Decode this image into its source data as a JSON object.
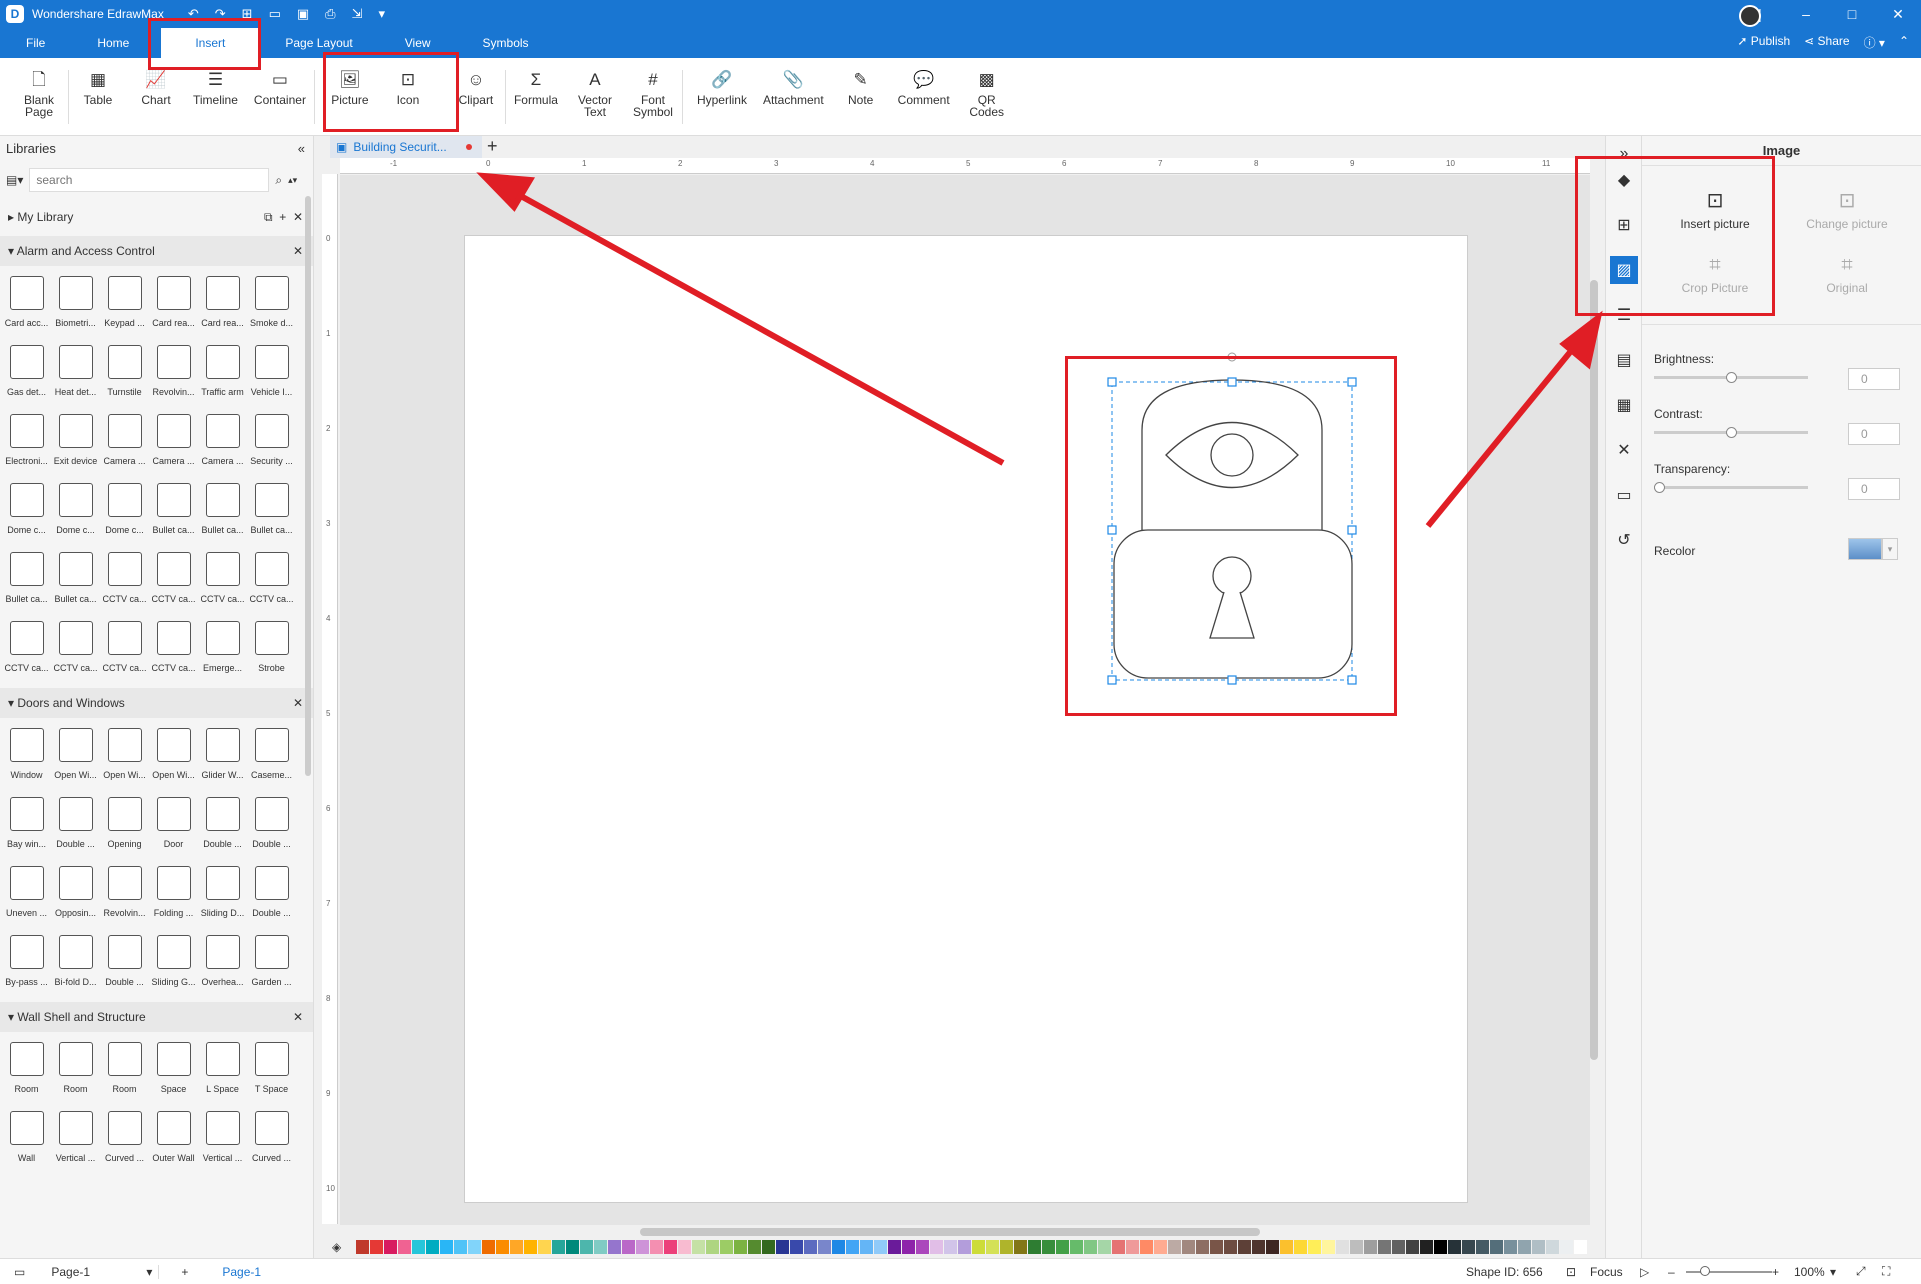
{
  "app": {
    "title": "Wondershare EdrawMax"
  },
  "menu": {
    "tabs": [
      "File",
      "Home",
      "Insert",
      "Page Layout",
      "View",
      "Symbols"
    ],
    "publish": "Publish",
    "share": "Share"
  },
  "ribbon": {
    "blank_page": "Blank\nPage",
    "table": "Table",
    "chart": "Chart",
    "timeline": "Timeline",
    "container": "Container",
    "picture": "Picture",
    "icon": "Icon",
    "clipart": "Clipart",
    "formula": "Formula",
    "vector_text": "Vector\nText",
    "font_symbol": "Font\nSymbol",
    "hyperlink": "Hyperlink",
    "attachment": "Attachment",
    "note": "Note",
    "comment": "Comment",
    "qr_codes": "QR\nCodes"
  },
  "libraries": {
    "title": "Libraries",
    "search_placeholder": "search",
    "my_library": "My Library",
    "sections": [
      {
        "name": "Alarm and Access Control",
        "shapes": [
          "Card acc...",
          "Biometri...",
          "Keypad ...",
          "Card rea...",
          "Card rea...",
          "Smoke d...",
          "Gas det...",
          "Heat det...",
          "Turnstile",
          "Revolvin...",
          "Traffic arm",
          "Vehicle I...",
          "Electroni...",
          "Exit device",
          "Camera ...",
          "Camera ...",
          "Camera ...",
          "Security ...",
          "Dome c...",
          "Dome c...",
          "Dome c...",
          "Bullet ca...",
          "Bullet ca...",
          "Bullet ca...",
          "Bullet ca...",
          "Bullet ca...",
          "CCTV ca...",
          "CCTV ca...",
          "CCTV ca...",
          "CCTV ca...",
          "CCTV ca...",
          "CCTV ca...",
          "CCTV ca...",
          "CCTV ca...",
          "Emerge...",
          "Strobe"
        ]
      },
      {
        "name": "Doors and Windows",
        "shapes": [
          "Window",
          "Open Wi...",
          "Open Wi...",
          "Open Wi...",
          "Glider W...",
          "Caseme...",
          "Bay win...",
          "Double ...",
          "Opening",
          "Door",
          "Double ...",
          "Double ...",
          "Uneven ...",
          "Opposin...",
          "Revolvin...",
          "Folding ...",
          "Sliding D...",
          "Double ...",
          "By-pass ...",
          "Bi-fold D...",
          "Double ...",
          "Sliding G...",
          "Overhea...",
          "Garden ..."
        ]
      },
      {
        "name": "Wall Shell and Structure",
        "shapes": [
          "Room",
          "Room",
          "Room",
          "Space",
          "L Space",
          "T Space",
          "Wall",
          "Vertical ...",
          "Curved ...",
          "Outer Wall",
          "Vertical ...",
          "Curved ..."
        ]
      }
    ]
  },
  "document": {
    "tab_name": "Building Securit..."
  },
  "ruler": {
    "h": [
      "-1",
      "0",
      "1",
      "2",
      "3",
      "4",
      "5",
      "6",
      "7",
      "8",
      "9",
      "10",
      "11"
    ],
    "v": [
      "0",
      "1",
      "2",
      "3",
      "4",
      "5",
      "6",
      "7",
      "8",
      "9",
      "10"
    ]
  },
  "panel": {
    "title": "Image",
    "insert_picture": "Insert picture",
    "change_picture": "Change picture",
    "crop_picture": "Crop Picture",
    "original": "Original",
    "brightness": "Brightness:",
    "contrast": "Contrast:",
    "transparency": "Transparency:",
    "recolor": "Recolor",
    "brightness_value": "0",
    "contrast_value": "0",
    "transparency_value": "0"
  },
  "status": {
    "page_select": "Page-1",
    "page_tab": "Page-1",
    "shape_id": "Shape ID: 656",
    "focus": "Focus",
    "zoom": "100%"
  },
  "colors": {
    "accent": "#1976d2",
    "highlight": "#e01e25",
    "palette": [
      "#c0392b",
      "#e53935",
      "#d81b60",
      "#f06292",
      "#26c6da",
      "#00acc1",
      "#29b6f6",
      "#4fc3f7",
      "#81d4fa",
      "#ef6c00",
      "#fb8c00",
      "#ffa726",
      "#ffb300",
      "#ffd54f",
      "#26a69a",
      "#00897b",
      "#4db6ac",
      "#80cbc4",
      "#9575cd",
      "#ba68c8",
      "#ce93d8",
      "#f48fb1",
      "#ec407a",
      "#f8bbd0",
      "#c5e1a5",
      "#aed581",
      "#9ccc65",
      "#7cb342",
      "#558b2f",
      "#33691e",
      "#283593",
      "#3949ab",
      "#5c6bc0",
      "#7986cb",
      "#1e88e5",
      "#42a5f5",
      "#64b5f6",
      "#90caf9",
      "#6a1b9a",
      "#8e24aa",
      "#ab47bc",
      "#e1bee7",
      "#d1c4e9",
      "#b39ddb",
      "#cddc39",
      "#d4e157",
      "#afb42b",
      "#827717",
      "#2e7d32",
      "#388e3c",
      "#43a047",
      "#66bb6a",
      "#81c784",
      "#a5d6a7",
      "#e57373",
      "#ef9a9a",
      "#ff8a65",
      "#ffab91",
      "#bcaaa4",
      "#a1887f",
      "#8d6e63",
      "#795548",
      "#6d4c41",
      "#5d4037",
      "#4e342e",
      "#3e2723",
      "#fbc02d",
      "#fdd835",
      "#ffee58",
      "#fff59d",
      "#e0e0e0",
      "#bdbdbd",
      "#9e9e9e",
      "#757575",
      "#616161",
      "#424242",
      "#212121",
      "#000000",
      "#263238",
      "#37474f",
      "#455a64",
      "#546e7a",
      "#78909c",
      "#90a4ae",
      "#b0bec5",
      "#cfd8dc",
      "#eceff1",
      "#ffffff"
    ]
  }
}
